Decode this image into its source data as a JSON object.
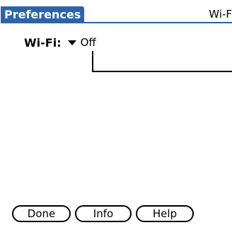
{
  "header": {
    "title": "Preferences",
    "panel_name": "Wi-F"
  },
  "wifi": {
    "label": "Wi-Fi:",
    "value": "Off",
    "picker_icon": "triangle-down-icon"
  },
  "buttons": {
    "done": "Done",
    "info": "Info",
    "help": "Help"
  },
  "colors": {
    "title_bar": "#2d63a8",
    "background": "#ffffff",
    "text": "#000000"
  }
}
